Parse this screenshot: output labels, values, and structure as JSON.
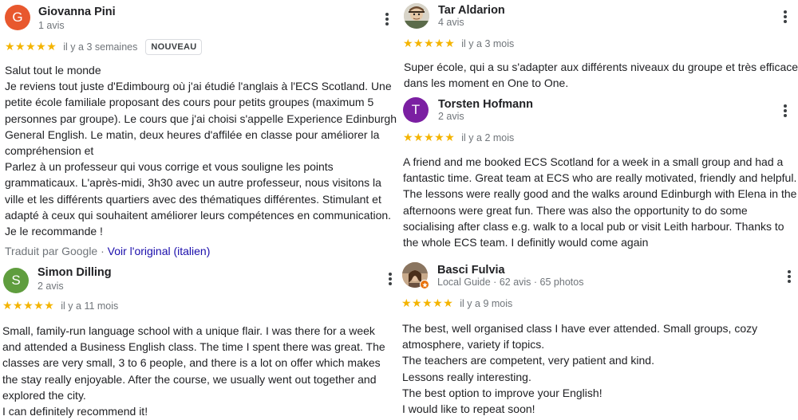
{
  "colors": {
    "star": "#f4b400",
    "link": "#1a0dab",
    "meta": "#70757a"
  },
  "reviews": [
    {
      "name": "Giovanna Pini",
      "initial": "G",
      "avatar_color": "#e8582e",
      "meta": "1 avis",
      "stars": "★★★★★",
      "when": "il y a 3 semaines",
      "badge": "NOUVEAU",
      "lines": [
        "Salut tout le monde",
        "Je reviens tout juste d'Edimbourg où j'ai étudié l'anglais à l'ECS Scotland. Une",
        "petite école familiale proposant des cours pour petits groupes (maximum 5",
        "personnes par groupe). Le cours que j'ai choisi s'appelle Experience Edinburgh",
        "General English. Le matin, deux heures d'affilée en classe pour améliorer la",
        "compréhension et",
        "Parlez à un professeur qui vous corrige et vous souligne les points",
        "grammaticaux. L'après-midi, 3h30 avec un autre professeur, nous visitons la",
        "ville et les différents quartiers avec des thématiques différentes. Stimulant et",
        "adapté à ceux qui souhaitent améliorer leurs compétences en communication.",
        "Je le recommande !"
      ],
      "translated_label": "Traduit par Google ·",
      "translated_link": "Voir l'original (italien)"
    },
    {
      "name": "Simon Dilling",
      "initial": "S",
      "avatar_color": "#5f9d3e",
      "meta": "2 avis",
      "stars": "★★★★★",
      "when": "il y a 11 mois",
      "lines": [
        "Small, family-run language school with a unique flair. I was there for a week",
        "and attended a Business English class. The time I spent there was great. The",
        "classes are very small, 3 to 6 people, and there is a lot on offer which makes",
        "the stay really enjoyable. After the course, we usually went out together and",
        "explored the city.",
        "I can definitely recommend it!"
      ]
    },
    {
      "name": "Tar Aldarion",
      "meta": "4 avis",
      "stars": "★★★★★",
      "when": "il y a 3 mois",
      "lines": [
        "Super école, qui a su s'adapter aux différents niveaux du groupe et très efficace",
        "dans les moment en One to One."
      ]
    },
    {
      "name": "Torsten Hofmann",
      "initial": "T",
      "avatar_color": "#7b1fa2",
      "meta": "2 avis",
      "stars": "★★★★★",
      "when": "il y a 2 mois",
      "lines": [
        "A friend and me booked ECS Scotland for a week in a small group and had a",
        "fantastic time. Great team at ECS who are really motivated, friendly and helpful.",
        "The lessons were really good and the walks around Edinburgh with Elena in the",
        "afternoons were great fun. There was also the opportunity to do some",
        "socialising after class e.g. walk to a local pub or visit Leith harbour. Thanks to",
        "the whole ECS team. I definitly would come again"
      ]
    },
    {
      "name": "Basci Fulvia",
      "meta": "Local Guide · 62 avis · 65 photos",
      "stars": "★★★★★",
      "when": "il y a 9 mois",
      "lines": [
        "The best, well organised class I have ever attended. Small groups, cozy",
        "atmosphere, variety if topics.",
        "The teachers are competent, very patient and kind.",
        "Lessons really interesting.",
        "The best option to improve your English!",
        "I would like to repeat soon!"
      ]
    }
  ]
}
